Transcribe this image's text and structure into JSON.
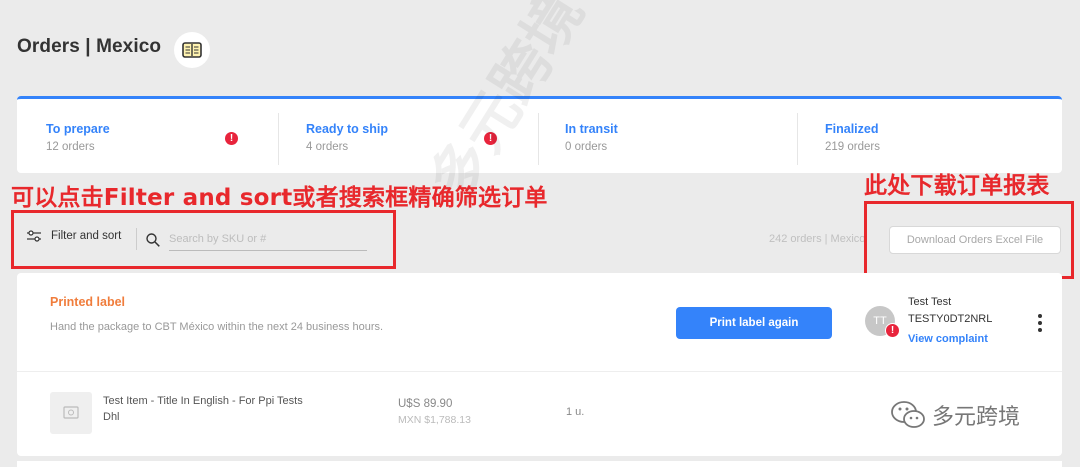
{
  "header": {
    "title": "Orders | Mexico",
    "guide_icon": "book-icon"
  },
  "colors": {
    "accent": "#3483fa",
    "alert": "#e8243c",
    "annotation": "#e8282c",
    "status_orange": "#f07d3c"
  },
  "tabs": [
    {
      "label": "To prepare",
      "count": "12 orders",
      "alert": "!"
    },
    {
      "label": "Ready to ship",
      "count": "4 orders",
      "alert": "!"
    },
    {
      "label": "In transit",
      "count": "0 orders"
    },
    {
      "label": "Finalized",
      "count": "219 orders"
    }
  ],
  "annotations": {
    "filter_note": "可以点击Filter and sort或者搜索框精确筛选订单",
    "download_note": "此处下载订单报表"
  },
  "toolbar": {
    "filter_label": "Filter and sort",
    "search_placeholder": "Search by SKU or #",
    "orders_count": "242 orders | Mexico",
    "download_label": "Download Orders Excel File"
  },
  "order": {
    "status_title": "Printed label",
    "status_desc": "Hand the package to CBT México within the next 24 business hours.",
    "print_button": "Print label again",
    "buyer": {
      "initials": "TT",
      "name": "Test Test",
      "id": "TESTY0DT2NRL",
      "alert": "!"
    },
    "complaint_link": "View complaint",
    "item": {
      "title": "Test Item - Title In English - For Ppi Tests",
      "carrier": "Dhl",
      "price_usd": "U$S 89.90",
      "price_mxn": "MXN $1,788.13",
      "quantity": "1 u."
    }
  },
  "watermark": {
    "diagonal": "多元跨境",
    "logo_text": "多元跨境"
  }
}
